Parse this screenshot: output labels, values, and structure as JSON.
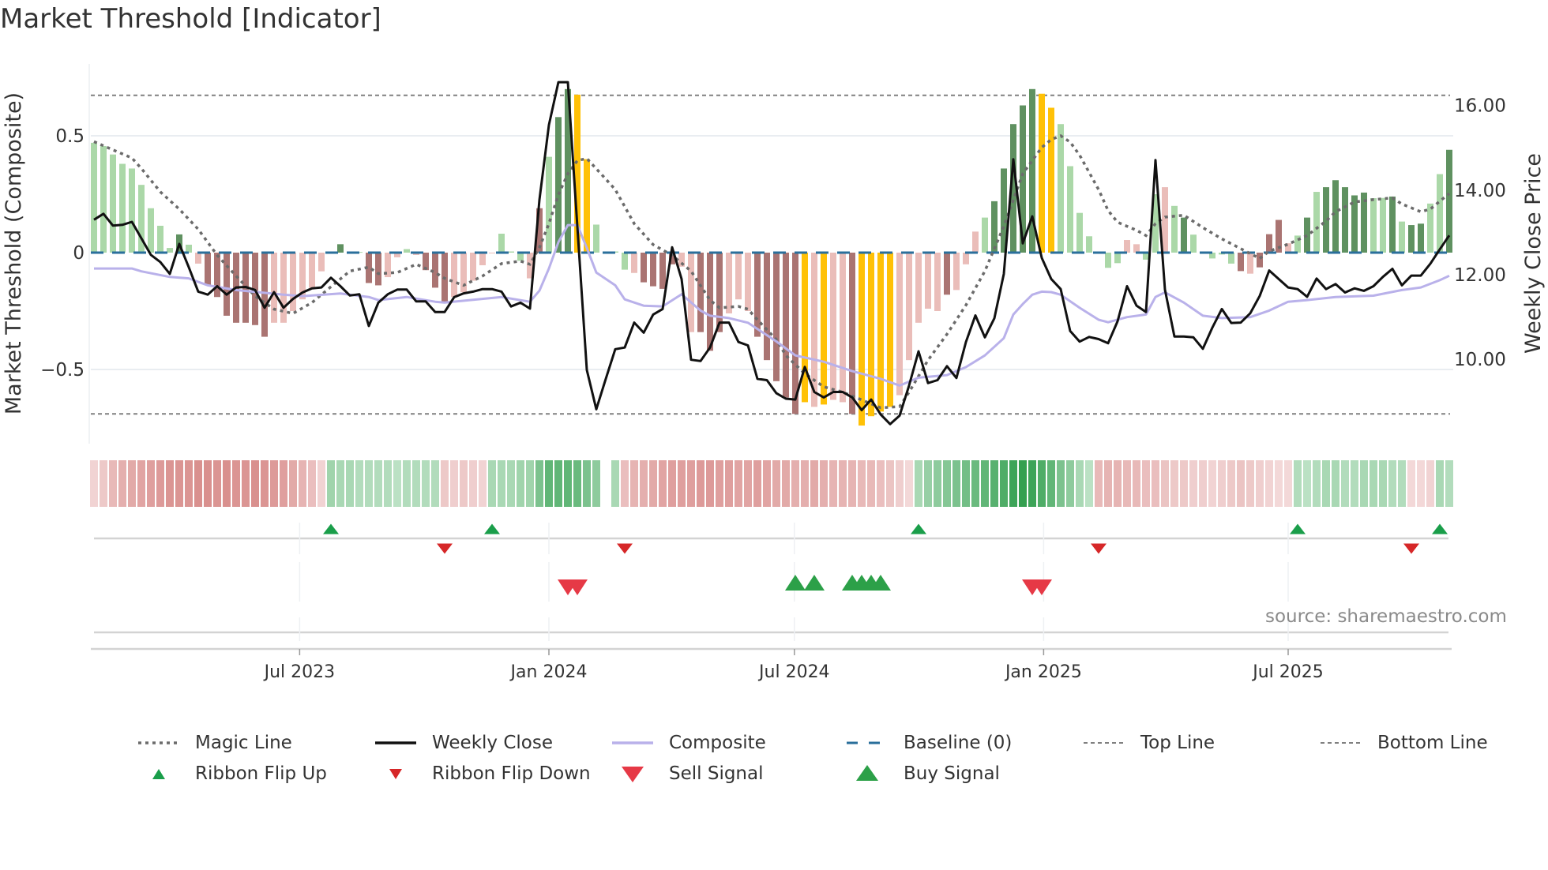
{
  "title": "Market Threshold [Indicator]",
  "source": "source: sharemaestro.com",
  "colors": {
    "bar_strong_pos": "#5f9160",
    "bar_weak_pos": "#abd8a8",
    "bar_strong_neg": "#aa7472",
    "bar_weak_neg": "#eabdb9",
    "bar_extreme": "#ffc107",
    "weekly_close": "#111111",
    "composite": "#b9b1ea",
    "magic": "#6b6b6b",
    "baseline": "#2a6f9b",
    "threshold": "#808080",
    "flip_up": "#1a9e4a",
    "flip_down": "#d62728",
    "sell": "#e63946",
    "buy": "#2ca048"
  },
  "chart_data": {
    "type": "bar+line",
    "title": "Market Threshold [Indicator]",
    "ylabel": "Market Threshold (Composite)",
    "y2label": "Weekly Close Price",
    "xlabel": "",
    "x_unit": "week index",
    "ylim": [
      -0.86,
      0.81
    ],
    "y2lim": [
      8.2,
      17.5
    ],
    "yticks": [
      {
        "value": 0.5,
        "label": "0.5"
      },
      {
        "value": 0,
        "label": "0"
      },
      {
        "value": -0.5,
        "label": "−0.5"
      }
    ],
    "y2ticks": [
      {
        "value": 16,
        "label": "16.00"
      },
      {
        "value": 14,
        "label": "14.00"
      },
      {
        "value": 12,
        "label": "12.00"
      },
      {
        "value": 10,
        "label": "10.00"
      }
    ],
    "xticks": [
      {
        "week": 21.7,
        "label": "Jul 2023"
      },
      {
        "week": 48,
        "label": "Jan 2024"
      },
      {
        "week": 73.9,
        "label": "Jul 2024"
      },
      {
        "week": 100.2,
        "label": "Jan 2025"
      },
      {
        "week": 126,
        "label": "Jul 2025"
      }
    ],
    "top_line": 0.673,
    "bottom_line": -0.69,
    "baseline": 0,
    "composite_bars": [
      0.47,
      0.456,
      0.42,
      0.38,
      0.36,
      0.29,
      0.19,
      0.115,
      0.02,
      0.078,
      0.034,
      -0.047,
      -0.14,
      -0.19,
      -0.27,
      -0.3,
      -0.3,
      -0.31,
      -0.36,
      -0.3,
      -0.3,
      -0.25,
      -0.2,
      -0.15,
      -0.08,
      0.003,
      0.036,
      0.003,
      0.003,
      -0.13,
      -0.14,
      -0.105,
      -0.02,
      0.015,
      -0.01,
      -0.075,
      -0.15,
      -0.21,
      -0.19,
      -0.17,
      -0.12,
      -0.054,
      -0.003,
      0.081,
      0.005,
      -0.035,
      -0.11,
      0.19,
      0.41,
      0.58,
      0.7,
      0.676,
      0.4,
      0.12,
      0.003,
      0.005,
      -0.073,
      -0.087,
      -0.127,
      -0.144,
      -0.155,
      -0.05,
      -0.06,
      -0.34,
      -0.34,
      -0.42,
      -0.34,
      -0.26,
      -0.2,
      -0.25,
      -0.36,
      -0.46,
      -0.55,
      -0.62,
      -0.69,
      -0.64,
      -0.66,
      -0.65,
      -0.63,
      -0.64,
      -0.69,
      -0.74,
      -0.7,
      -0.68,
      -0.66,
      -0.61,
      -0.46,
      -0.3,
      -0.24,
      -0.25,
      -0.18,
      -0.16,
      -0.05,
      0.09,
      0.15,
      0.22,
      0.36,
      0.55,
      0.63,
      0.7,
      0.68,
      0.62,
      0.55,
      0.37,
      0.17,
      0.07,
      0.003,
      -0.065,
      -0.045,
      0.054,
      0.036,
      -0.03,
      0.25,
      0.28,
      0.2,
      0.15,
      0.077,
      0.003,
      -0.025,
      -0.008,
      -0.047,
      -0.079,
      -0.09,
      -0.063,
      0.079,
      0.14,
      0.04,
      0.073,
      0.15,
      0.26,
      0.28,
      0.31,
      0.28,
      0.245,
      0.257,
      0.233,
      0.234,
      0.24,
      0.133,
      0.118,
      0.124,
      0.21,
      0.336,
      0.44
    ],
    "bar_classes": "gggggggggGgrRRRRRRRrrrrrrgGggRRrrgrRRRrrrrrgggrRgGGYYggggrRRRRrrRRRrrrRRRRRYrYrrRYYYYrrrrrRrrrgGGGGGYYgggggggrrggrgGgggggRrRRRrgGgGGGGGggGgGGggGGGG",
    "weekly_close": [
      13.3,
      13.44,
      13.16,
      13.18,
      13.25,
      12.86,
      12.47,
      12.3,
      12.02,
      12.73,
      12.18,
      11.6,
      11.53,
      11.73,
      11.53,
      11.7,
      11.71,
      11.64,
      11.22,
      11.59,
      11.22,
      11.43,
      11.58,
      11.68,
      11.7,
      11.93,
      11.73,
      11.51,
      11.54,
      10.79,
      11.34,
      11.54,
      11.65,
      11.65,
      11.37,
      11.37,
      11.12,
      11.12,
      11.47,
      11.56,
      11.6,
      11.66,
      11.66,
      11.6,
      11.25,
      11.34,
      11.2,
      13.77,
      15.54,
      16.55,
      16.55,
      13.14,
      9.75,
      8.82,
      9.54,
      10.24,
      10.28,
      10.87,
      10.63,
      11.06,
      11.19,
      12.65,
      11.9,
      9.99,
      9.96,
      10.28,
      10.87,
      10.87,
      10.41,
      10.33,
      9.54,
      9.51,
      9.2,
      9.07,
      9.05,
      9.82,
      9.23,
      9.1,
      9.23,
      9.23,
      9.1,
      8.8,
      9.05,
      8.7,
      8.47,
      8.67,
      9.38,
      10.19,
      9.44,
      9.51,
      9.84,
      9.56,
      10.41,
      11.04,
      10.52,
      10.97,
      12.02,
      14.73,
      12.74,
      13.38,
      12.4,
      11.9,
      11.66,
      10.67,
      10.42,
      10.53,
      10.48,
      10.38,
      10.9,
      11.73,
      11.27,
      11.12,
      14.71,
      11.65,
      10.54,
      10.54,
      10.52,
      10.25,
      10.75,
      11.19,
      10.86,
      10.87,
      11.09,
      11.5,
      12.1,
      11.9,
      11.7,
      11.66,
      11.48,
      11.91,
      11.66,
      11.78,
      11.58,
      11.68,
      11.62,
      11.73,
      11.95,
      12.14,
      11.75,
      11.98,
      11.98,
      12.26,
      12.6,
      12.93
    ],
    "magic_line": [
      [
        0,
        0.475
      ],
      [
        2,
        0.44
      ],
      [
        4,
        0.405
      ],
      [
        5,
        0.36
      ],
      [
        7,
        0.26
      ],
      [
        9,
        0.186
      ],
      [
        11,
        0.1
      ],
      [
        13,
        -0.011
      ],
      [
        15,
        -0.1
      ],
      [
        17,
        -0.186
      ],
      [
        19,
        -0.242
      ],
      [
        21,
        -0.26
      ],
      [
        23,
        -0.214
      ],
      [
        25,
        -0.146
      ],
      [
        27,
        -0.079
      ],
      [
        29,
        -0.062
      ],
      [
        30,
        -0.09
      ],
      [
        32,
        -0.085
      ],
      [
        34,
        -0.05
      ],
      [
        36,
        -0.085
      ],
      [
        37,
        -0.11
      ],
      [
        39,
        -0.14
      ],
      [
        41,
        -0.1
      ],
      [
        43,
        -0.047
      ],
      [
        45,
        -0.036
      ],
      [
        46,
        -0.05
      ],
      [
        47,
        0.022
      ],
      [
        48,
        0.124
      ],
      [
        49,
        0.248
      ],
      [
        50,
        0.338
      ],
      [
        51,
        0.394
      ],
      [
        52,
        0.403
      ],
      [
        54,
        0.315
      ],
      [
        55,
        0.27
      ],
      [
        57,
        0.124
      ],
      [
        59,
        0.034
      ],
      [
        61,
        -0.011
      ],
      [
        63,
        -0.079
      ],
      [
        65,
        -0.203
      ],
      [
        66,
        -0.236
      ],
      [
        68,
        -0.23
      ],
      [
        69,
        -0.242
      ],
      [
        70,
        -0.287
      ],
      [
        72,
        -0.372
      ],
      [
        73,
        -0.44
      ],
      [
        75,
        -0.518
      ],
      [
        77,
        -0.574
      ],
      [
        79,
        -0.597
      ],
      [
        81,
        -0.63
      ],
      [
        83,
        -0.664
      ],
      [
        85,
        -0.659
      ],
      [
        86,
        -0.597
      ],
      [
        88,
        -0.46
      ],
      [
        90,
        -0.349
      ],
      [
        92,
        -0.225
      ],
      [
        94,
        -0.079
      ],
      [
        96,
        0.113
      ],
      [
        98,
        0.338
      ],
      [
        100,
        0.45
      ],
      [
        101,
        0.484
      ],
      [
        102,
        0.5
      ],
      [
        103,
        0.473
      ],
      [
        104,
        0.417
      ],
      [
        106,
        0.27
      ],
      [
        107,
        0.18
      ],
      [
        108,
        0.13
      ],
      [
        109,
        0.113
      ],
      [
        110,
        0.096
      ],
      [
        111,
        0.073
      ],
      [
        112,
        0.124
      ],
      [
        113,
        0.152
      ],
      [
        115,
        0.16
      ],
      [
        117,
        0.107
      ],
      [
        119,
        0.059
      ],
      [
        121,
        0.017
      ],
      [
        123,
        -0.025
      ],
      [
        124,
        0.006
      ],
      [
        126,
        0.036
      ],
      [
        128,
        0.073
      ],
      [
        130,
        0.135
      ],
      [
        131,
        0.175
      ],
      [
        133,
        0.217
      ],
      [
        135,
        0.227
      ],
      [
        137,
        0.234
      ],
      [
        138,
        0.208
      ],
      [
        140,
        0.175
      ],
      [
        141,
        0.186
      ],
      [
        142,
        0.22
      ],
      [
        143,
        0.253
      ]
    ],
    "composite_line": [
      [
        0,
        -0.068
      ],
      [
        4,
        -0.068
      ],
      [
        5,
        -0.08
      ],
      [
        8,
        -0.104
      ],
      [
        10,
        -0.11
      ],
      [
        12,
        -0.14
      ],
      [
        15,
        -0.16
      ],
      [
        20,
        -0.18
      ],
      [
        22,
        -0.186
      ],
      [
        26,
        -0.175
      ],
      [
        29,
        -0.19
      ],
      [
        30,
        -0.203
      ],
      [
        33,
        -0.19
      ],
      [
        36,
        -0.21
      ],
      [
        37,
        -0.214
      ],
      [
        43,
        -0.19
      ],
      [
        46,
        -0.21
      ],
      [
        47,
        -0.163
      ],
      [
        48,
        -0.068
      ],
      [
        49,
        0.045
      ],
      [
        50,
        0.118
      ],
      [
        51,
        0.118
      ],
      [
        52,
        0.02
      ],
      [
        53,
        -0.085
      ],
      [
        55,
        -0.14
      ],
      [
        56,
        -0.2
      ],
      [
        58,
        -0.227
      ],
      [
        60,
        -0.23
      ],
      [
        62,
        -0.178
      ],
      [
        64,
        -0.248
      ],
      [
        65,
        -0.27
      ],
      [
        67,
        -0.28
      ],
      [
        69,
        -0.3
      ],
      [
        72,
        -0.38
      ],
      [
        74,
        -0.44
      ],
      [
        77,
        -0.467
      ],
      [
        80,
        -0.507
      ],
      [
        83,
        -0.54
      ],
      [
        85,
        -0.569
      ],
      [
        87,
        -0.535
      ],
      [
        90,
        -0.524
      ],
      [
        92,
        -0.49
      ],
      [
        94,
        -0.44
      ],
      [
        96,
        -0.366
      ],
      [
        97,
        -0.265
      ],
      [
        98,
        -0.22
      ],
      [
        99,
        -0.18
      ],
      [
        100,
        -0.167
      ],
      [
        101,
        -0.169
      ],
      [
        102,
        -0.18
      ],
      [
        104,
        -0.236
      ],
      [
        106,
        -0.287
      ],
      [
        107,
        -0.298
      ],
      [
        109,
        -0.276
      ],
      [
        111,
        -0.265
      ],
      [
        112,
        -0.19
      ],
      [
        113,
        -0.17
      ],
      [
        115,
        -0.214
      ],
      [
        117,
        -0.27
      ],
      [
        119,
        -0.28
      ],
      [
        122,
        -0.276
      ],
      [
        124,
        -0.248
      ],
      [
        126,
        -0.21
      ],
      [
        128,
        -0.203
      ],
      [
        131,
        -0.19
      ],
      [
        135,
        -0.184
      ],
      [
        138,
        -0.16
      ],
      [
        140,
        -0.149
      ],
      [
        142,
        -0.118
      ],
      [
        143,
        -0.099
      ]
    ],
    "ribbon": [
      -0.2,
      -0.3,
      -0.45,
      -0.55,
      -0.6,
      -0.65,
      -0.7,
      -0.75,
      -0.8,
      -0.8,
      -0.8,
      -0.85,
      -0.85,
      -0.8,
      -0.85,
      -0.8,
      -0.8,
      -0.85,
      -0.8,
      -0.75,
      -0.7,
      -0.6,
      -0.5,
      -0.4,
      -0.2,
      0.4,
      0.35,
      0.35,
      0.3,
      0.3,
      0.3,
      0.3,
      0.25,
      0.3,
      0.3,
      0.3,
      0.3,
      -0.3,
      -0.25,
      -0.3,
      -0.25,
      -0.2,
      0.35,
      0.35,
      0.35,
      0.4,
      0.4,
      0.6,
      0.75,
      0.75,
      0.75,
      0.7,
      0.6,
      0.5,
      null,
      0.35,
      -0.4,
      -0.5,
      -0.55,
      -0.6,
      -0.65,
      -0.7,
      -0.7,
      -0.7,
      -0.75,
      -0.75,
      -0.7,
      -0.7,
      -0.65,
      -0.65,
      -0.7,
      -0.65,
      -0.6,
      -0.6,
      -0.55,
      -0.55,
      -0.6,
      -0.55,
      -0.5,
      -0.5,
      -0.5,
      -0.45,
      -0.45,
      -0.4,
      -0.35,
      -0.25,
      -0.15,
      0.35,
      0.45,
      0.5,
      0.55,
      0.6,
      0.65,
      0.7,
      0.75,
      0.8,
      0.85,
      0.95,
      1.0,
      0.95,
      0.85,
      0.75,
      0.6,
      0.5,
      0.35,
      0.25,
      -0.45,
      -0.5,
      -0.5,
      -0.45,
      -0.45,
      -0.4,
      -0.4,
      -0.35,
      -0.3,
      -0.3,
      -0.25,
      -0.25,
      -0.2,
      -0.25,
      -0.3,
      -0.35,
      -0.3,
      -0.25,
      -0.2,
      -0.15,
      -0.15,
      0.3,
      0.25,
      0.3,
      0.35,
      0.35,
      0.3,
      0.3,
      0.35,
      0.35,
      0.35,
      0.3,
      0.3,
      -0.15,
      -0.15,
      -0.2,
      0.35,
      0.3
    ],
    "ribbon_flip_up": [
      25,
      42,
      87,
      127,
      142
    ],
    "ribbon_flip_down": [
      37,
      56,
      106,
      139
    ],
    "sell_signals": [
      50,
      51,
      99,
      100
    ],
    "buy_signals": [
      74,
      76,
      80,
      81,
      82,
      83
    ],
    "legend": {
      "placement": "bottom",
      "items": [
        {
          "label": "Magic Line",
          "kind": "dotted"
        },
        {
          "label": "Weekly Close",
          "kind": "solid-black"
        },
        {
          "label": "Composite",
          "kind": "solid-lavender"
        },
        {
          "label": "Baseline (0)",
          "kind": "dashed-blue"
        },
        {
          "label": "Top Line",
          "kind": "dotted-thin"
        },
        {
          "label": "Bottom Line",
          "kind": "dotted-thin"
        },
        {
          "label": "Ribbon Flip Up",
          "kind": "tri-up-small"
        },
        {
          "label": "Ribbon Flip Down",
          "kind": "tri-down-small"
        },
        {
          "label": "Sell Signal",
          "kind": "tri-down-big"
        },
        {
          "label": "Buy Signal",
          "kind": "tri-up-big"
        }
      ]
    }
  }
}
